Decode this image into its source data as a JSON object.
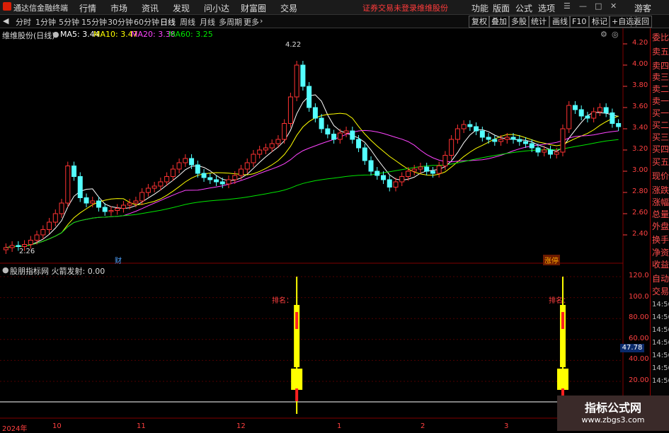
{
  "app": {
    "title": "通达信金融终端",
    "menu": [
      "行情",
      "市场",
      "资讯",
      "发现",
      "问小达",
      "财富圈",
      "交易"
    ],
    "notice": "证券交易未登录",
    "notice_stock": "维维股份",
    "right_menu": [
      "功能",
      "版面",
      "公式",
      "选项"
    ],
    "user": "游客"
  },
  "toolbar": {
    "periods": [
      "分时",
      "1分钟",
      "5分钟",
      "15分钟",
      "30分钟",
      "60分钟",
      "日线",
      "周线",
      "月线",
      "多周期",
      "更多"
    ],
    "active": "日线",
    "right_buttons": [
      "复权",
      "叠加",
      "多股",
      "统计",
      "画线",
      "F10",
      "标记",
      "+自选",
      "返回"
    ]
  },
  "stock": {
    "name": "维维股份(日线)",
    "ma5": "MA5: 3.44",
    "ma10": "MA10: 3.47",
    "ma20": "MA20: 3.38",
    "ma60": "MA60: 3.25",
    "high_label": "4.22",
    "low_label": "2.26",
    "marker_cai": "财",
    "marker_zt": "涨停"
  },
  "colors": {
    "up": "#ff3232",
    "down": "#54ffff",
    "ma5": "#ffffff",
    "ma10": "#ffff00",
    "ma20": "#ff44ff",
    "ma60": "#00e600",
    "axis": "#ff4040",
    "grid": "#800000"
  },
  "price_axis": [
    "4.20",
    "4.00",
    "3.80",
    "3.60",
    "3.40",
    "3.20",
    "3.00",
    "2.80",
    "2.60",
    "2.40"
  ],
  "indicator": {
    "label": "股朋指标网 火箭发射: 0.00",
    "ticks": [
      "120.0",
      "100.0",
      "80.00",
      "60.00",
      "40.00",
      "20.00"
    ],
    "rank_label": "排名：",
    "current_value": "47.78",
    "times": [
      "14:56",
      "14:56",
      "14:56",
      "14:56",
      "14:56",
      "14:56",
      "14:56"
    ]
  },
  "sidebar": {
    "items": [
      "委比",
      "卖五",
      "卖四",
      "卖三",
      "卖二",
      "卖一",
      "买一",
      "买二",
      "买三",
      "买四",
      "买五",
      "现价",
      "涨跌",
      "涨幅",
      "总量",
      "外盘",
      "换手",
      "净资",
      "收益"
    ],
    "tabs": [
      "自动",
      "交易"
    ]
  },
  "date_axis": [
    "2024年",
    "10",
    "11",
    "12",
    "1",
    "2",
    "3"
  ],
  "watermark": {
    "title": "指标公式网",
    "url": "www.zbgs3.com"
  },
  "chart_data": {
    "type": "candlestick",
    "title": "维维股份(日线)",
    "ylim": [
      2.2,
      4.3
    ],
    "candles_note": "daily OHLC, approx. read from chart",
    "closes": [
      2.28,
      2.3,
      2.29,
      2.31,
      2.35,
      2.4,
      2.45,
      2.52,
      2.6,
      2.7,
      3.05,
      2.95,
      2.75,
      2.7,
      2.72,
      2.66,
      2.62,
      2.63,
      2.65,
      2.68,
      2.7,
      2.72,
      2.8,
      2.84,
      2.86,
      2.9,
      2.95,
      3.02,
      3.08,
      3.12,
      3.06,
      2.98,
      2.94,
      2.92,
      2.9,
      2.88,
      2.92,
      2.96,
      3.02,
      3.08,
      3.16,
      3.2,
      3.22,
      3.26,
      3.3,
      3.45,
      3.7,
      4.0,
      3.8,
      3.6,
      3.5,
      3.4,
      3.35,
      3.3,
      3.36,
      3.38,
      3.3,
      3.22,
      3.1,
      3.0,
      2.96,
      2.92,
      2.85,
      2.9,
      2.95,
      3.0,
      3.02,
      3.04,
      3.0,
      2.98,
      3.05,
      3.15,
      3.3,
      3.4,
      3.44,
      3.42,
      3.38,
      3.32,
      3.3,
      3.28,
      3.3,
      3.32,
      3.3,
      3.28,
      3.26,
      3.22,
      3.18,
      3.2,
      3.16,
      3.18,
      3.4,
      3.62,
      3.58,
      3.52,
      3.5,
      3.56,
      3.6,
      3.55,
      3.45,
      3.42
    ],
    "indicator_signals": [
      {
        "bar": 47,
        "value": 120
      },
      {
        "bar": 90,
        "value": 120
      }
    ]
  }
}
